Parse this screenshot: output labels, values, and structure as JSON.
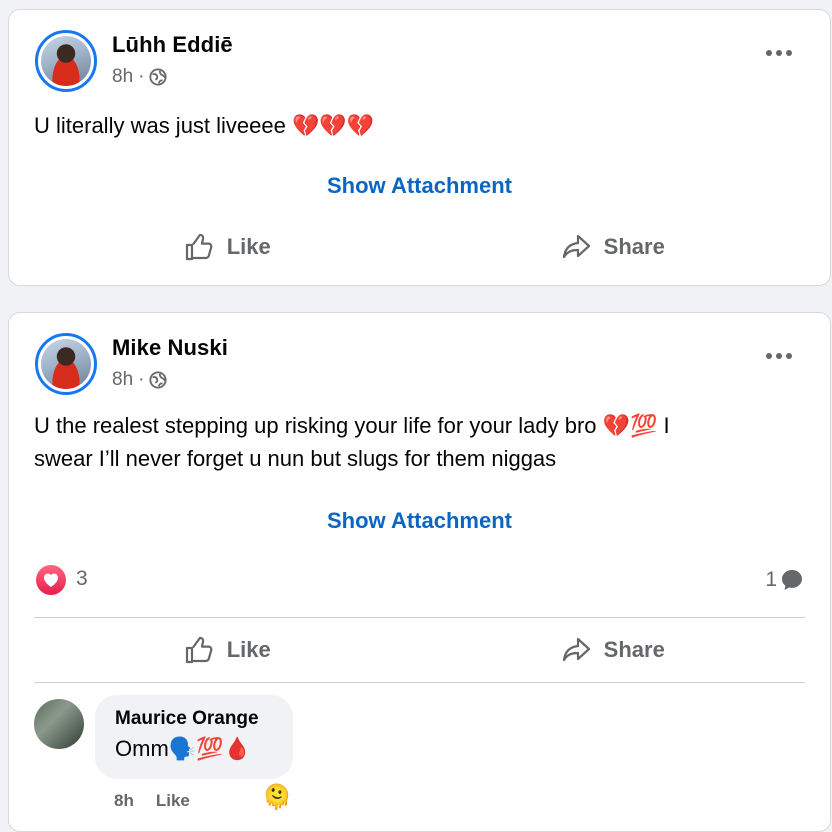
{
  "posts": [
    {
      "author": "Lūhh Eddiē",
      "time": "8h",
      "separator": "·",
      "visibility_icon": "globe-icon",
      "text": "U literally was just liveeee 💔💔💔",
      "attachment_label": "Show Attachment",
      "actions": {
        "like": "Like",
        "share": "Share"
      }
    },
    {
      "author": "Mike Nuski",
      "time": "8h",
      "separator": "·",
      "visibility_icon": "globe-icon",
      "text_line1": "U the realest stepping up risking your life for your lady bro 💔💯 I",
      "text_line2": "swear I’ll never forget u nun but slugs for them niggas",
      "attachment_label": "Show Attachment",
      "reaction_count": "3",
      "comment_count": "1",
      "actions": {
        "like": "Like",
        "share": "Share"
      },
      "comment": {
        "author": "Maurice Orange",
        "text": "Omm🗣️💯🩸",
        "time": "8h",
        "like": "Like",
        "reaction": "🫠"
      }
    }
  ],
  "colors": {
    "accent_blue": "#0a66c2",
    "avatar_ring": "#1877f2",
    "secondary_text": "#65676b",
    "heart": "#e61e4d"
  }
}
